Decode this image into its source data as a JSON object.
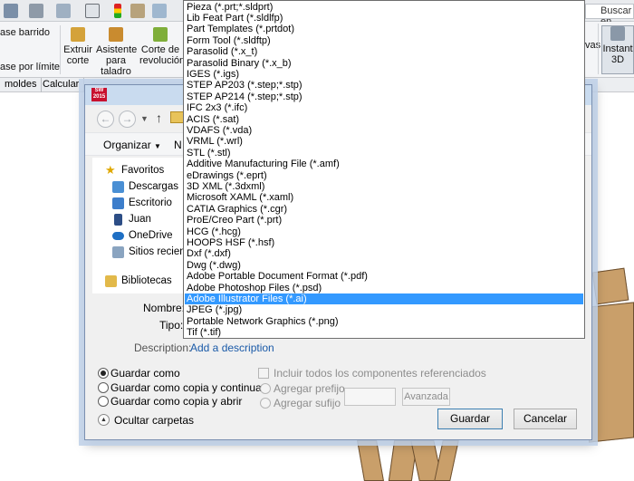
{
  "app": {
    "search_placeholder": "Buscar en",
    "ribbon_left": [
      "ase barrido",
      "ase por límite"
    ],
    "ribbon_buttons": [
      {
        "label": "Extruir\ncorte"
      },
      {
        "label": "Asistente\npara\ntaladro"
      },
      {
        "label": "Corte de\nrevolución"
      }
    ],
    "ribbon_right_partial": "vas",
    "instant3d_label": "Instant\n3D",
    "command_tabs": [
      "moldes",
      "Calcular"
    ]
  },
  "dialog": {
    "app_badge": "2015",
    "nav_pane_items": [
      "Favoritos",
      "Descargas",
      "Escritorio",
      "Juan",
      "OneDrive",
      "Sitios recientes",
      "Bibliotecas"
    ],
    "organize_label": "Organizar",
    "new_folder_partial": "N",
    "fields": {
      "nombre_label": "Nombre:",
      "tipo_label": "Tipo:",
      "description_label": "Description:",
      "description_link": "Add a description"
    },
    "save_options": [
      {
        "label": "Guardar como",
        "selected": true
      },
      {
        "label": "Guardar como copia y continuar",
        "selected": false
      },
      {
        "label": "Guardar como copia y abrir",
        "selected": false
      }
    ],
    "include_components_label": "Incluir todos los componentes referenciados",
    "prefix_label": "Agregar prefijo",
    "suffix_label": "Agregar sufijo",
    "advanced_button": "Avanzada",
    "hide_folders_label": "Ocultar carpetas",
    "save_button": "Guardar",
    "cancel_button": "Cancelar"
  },
  "filetype_dropdown": {
    "selected_index": 26,
    "selected_color": "#3399ff",
    "items": [
      "Pieza (*.prt;*.sldprt)",
      "Lib Feat Part (*.sldlfp)",
      "Part Templates (*.prtdot)",
      "Form Tool (*.sldftp)",
      "Parasolid (*.x_t)",
      "Parasolid Binary (*.x_b)",
      "IGES (*.igs)",
      "STEP AP203 (*.step;*.stp)",
      "STEP AP214 (*.step;*.stp)",
      "IFC 2x3 (*.ifc)",
      "ACIS (*.sat)",
      "VDAFS (*.vda)",
      "VRML (*.wrl)",
      "STL (*.stl)",
      "Additive Manufacturing File (*.amf)",
      "eDrawings (*.eprt)",
      "3D XML (*.3dxml)",
      "Microsoft XAML (*.xaml)",
      "CATIA Graphics (*.cgr)",
      "ProE/Creo Part (*.prt)",
      "HCG (*.hcg)",
      "HOOPS HSF (*.hsf)",
      "Dxf (*.dxf)",
      "Dwg (*.dwg)",
      "Adobe Portable Document Format (*.pdf)",
      "Adobe Photoshop Files (*.psd)",
      "Adobe Illustrator Files (*.ai)",
      "JPEG (*.jpg)",
      "Portable Network Graphics (*.png)",
      "Tif (*.tif)"
    ]
  }
}
